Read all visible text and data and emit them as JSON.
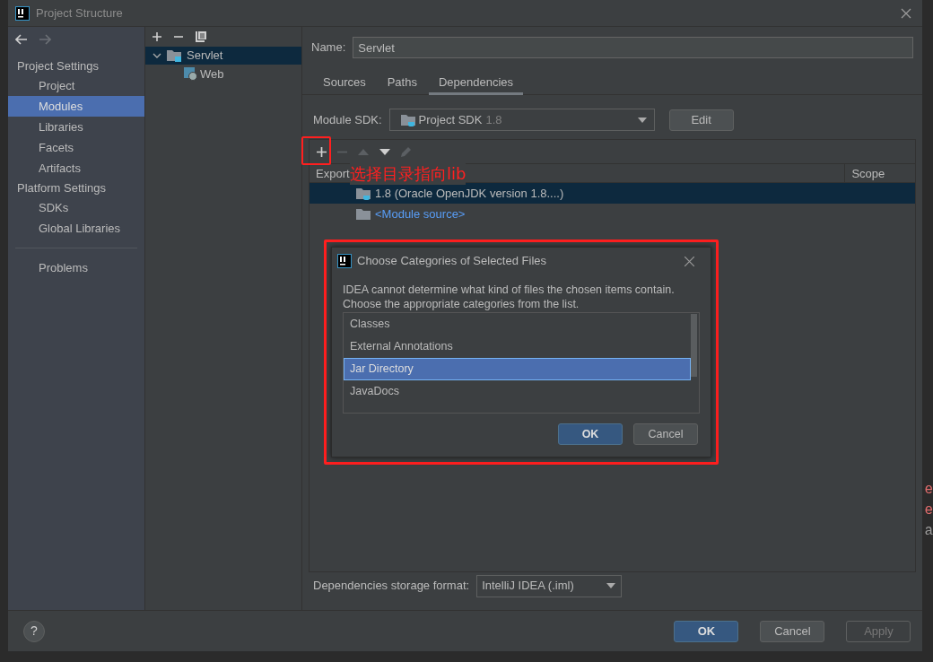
{
  "window": {
    "title": "Project Structure"
  },
  "sidebar": {
    "sections": [
      {
        "title": "Project Settings",
        "items": [
          {
            "label": "Project",
            "selected": false
          },
          {
            "label": "Modules",
            "selected": true
          },
          {
            "label": "Libraries",
            "selected": false
          },
          {
            "label": "Facets",
            "selected": false
          },
          {
            "label": "Artifacts",
            "selected": false
          }
        ]
      },
      {
        "title": "Platform Settings",
        "items": [
          {
            "label": "SDKs",
            "selected": false
          },
          {
            "label": "Global Libraries",
            "selected": false
          }
        ]
      }
    ],
    "extra_items": [
      {
        "label": "Problems",
        "selected": false
      }
    ]
  },
  "module_tree": [
    {
      "label": "Servlet",
      "expanded": true,
      "selected": true,
      "children": [
        {
          "label": "Web",
          "selected": false
        }
      ]
    }
  ],
  "name_field": {
    "label": "Name:",
    "value": "Servlet"
  },
  "tabs": [
    {
      "label": "Sources",
      "selected": false
    },
    {
      "label": "Paths",
      "selected": false
    },
    {
      "label": "Dependencies",
      "selected": true
    }
  ],
  "module_sdk": {
    "label": "Module SDK:",
    "value": "Project SDK",
    "version": "1.8",
    "edit_button": "Edit"
  },
  "dependencies": {
    "columns": [
      "Export",
      "Scope"
    ],
    "rows": [
      {
        "kind": "sdk",
        "text": "1.8 (Oracle OpenJDK version 1.8....)",
        "selected": true
      },
      {
        "kind": "source",
        "text": "<Module source>",
        "selected": false
      }
    ]
  },
  "annotation": "选择目录指向lib",
  "dialog": {
    "title": "Choose Categories of Selected Files",
    "message": [
      "IDEA cannot determine what kind of files the chosen items contain.",
      "Choose the appropriate categories from the list."
    ],
    "items": [
      {
        "label": "Classes",
        "selected": false
      },
      {
        "label": "External Annotations",
        "selected": false
      },
      {
        "label": "Jar Directory",
        "selected": true
      },
      {
        "label": "JavaDocs",
        "selected": false
      }
    ],
    "buttons": [
      {
        "label": "OK",
        "default": true
      },
      {
        "label": "Cancel",
        "default": false
      }
    ]
  },
  "storage_format": {
    "label": "Dependencies storage format:",
    "value": "IntelliJ IDEA (.iml)"
  },
  "help_button": "?",
  "footer_buttons": [
    {
      "label": "OK",
      "default": true,
      "disabled": false
    },
    {
      "label": "Cancel",
      "default": false,
      "disabled": false
    },
    {
      "label": "Apply",
      "default": false,
      "disabled": true
    }
  ],
  "console": {
    "edge_chars": [
      "e",
      "e",
      "a"
    ]
  }
}
